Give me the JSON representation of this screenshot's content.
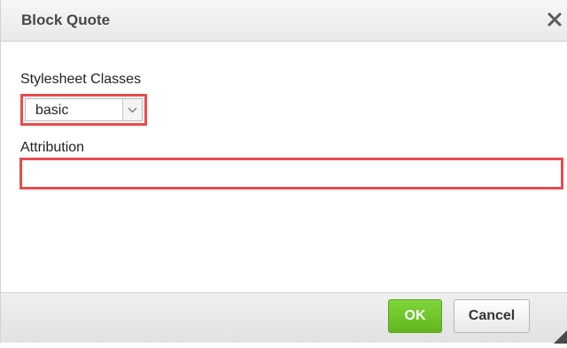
{
  "dialog": {
    "title": "Block Quote",
    "close_icon": "close-icon",
    "resize_icon": "resize-handle-icon"
  },
  "form": {
    "stylesheet_label": "Stylesheet Classes",
    "stylesheet_value": "basic",
    "attribution_label": "Attribution",
    "attribution_value": ""
  },
  "footer": {
    "ok_label": "OK",
    "cancel_label": "Cancel"
  },
  "colors": {
    "highlight_border": "#e84c4f",
    "ok_button": "#6cc12a"
  }
}
